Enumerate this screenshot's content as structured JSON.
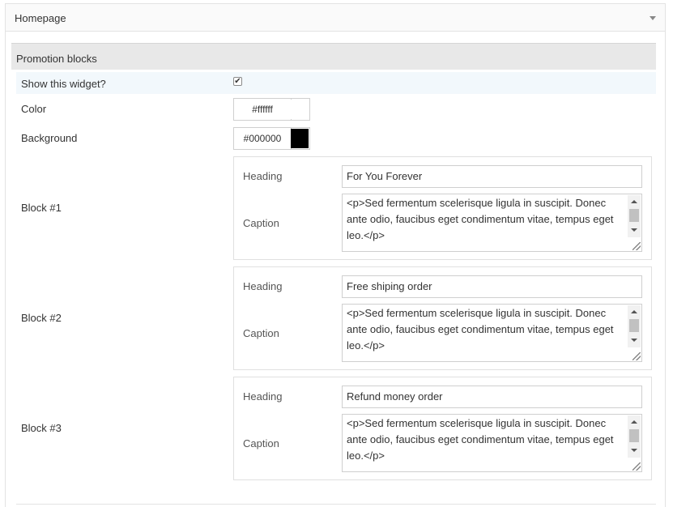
{
  "panel": {
    "title": "Homepage"
  },
  "section": {
    "title": "Promotion blocks"
  },
  "fields": {
    "show_widget": {
      "label": "Show this widget?",
      "checked": true,
      "check_glyph": "✔"
    },
    "color": {
      "label": "Color",
      "value": "#ffffff",
      "swatch": "#ffffff"
    },
    "background": {
      "label": "Background",
      "value": "#000000",
      "swatch": "#000000"
    }
  },
  "blocks": [
    {
      "label": "Block #1",
      "heading_label": "Heading",
      "heading_value": "For You Forever",
      "caption_label": "Caption",
      "caption_value": "<p>Sed fermentum scelerisque ligula in suscipit. Donec ante odio, faucibus eget condimentum vitae, tempus eget leo.</p>"
    },
    {
      "label": "Block #2",
      "heading_label": "Heading",
      "heading_value": "Free shiping order",
      "caption_label": "Caption",
      "caption_value": "<p>Sed fermentum scelerisque ligula in suscipit. Donec ante odio, faucibus eget condimentum vitae, tempus eget leo.</p>"
    },
    {
      "label": "Block #3",
      "heading_label": "Heading",
      "heading_value": "Refund money order",
      "caption_label": "Caption",
      "caption_value": "<p>Sed fermentum scelerisque ligula in suscipit. Donec ante odio, faucibus eget condimentum vitae, tempus eget leo.</p>"
    }
  ],
  "icons": {
    "panel_toggle": "chevron-down-icon",
    "checkbox": "checkmark-icon",
    "scroll_up": "arrow-up-icon",
    "scroll_down": "arrow-down-icon",
    "resize": "resize-grip-icon"
  }
}
